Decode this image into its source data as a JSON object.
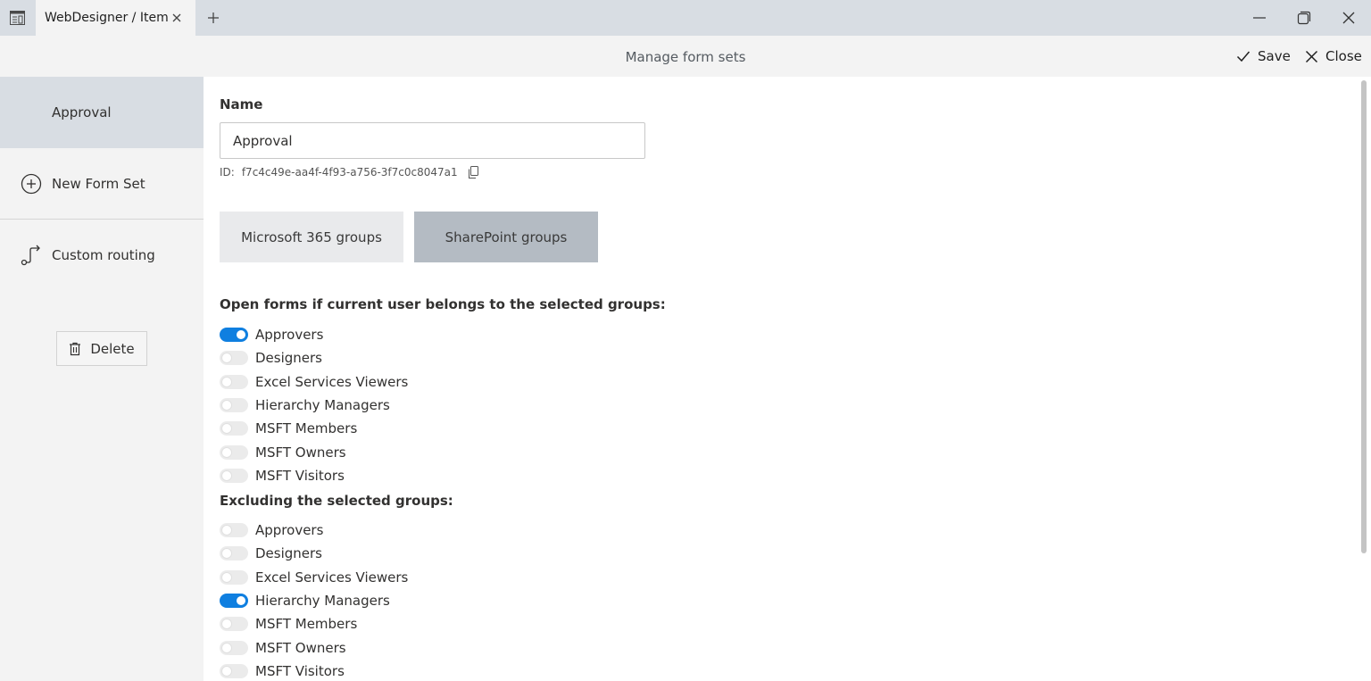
{
  "window": {
    "tab_title": "WebDesigner / Item",
    "icons": {
      "app": "app-window-icon",
      "tab_close": "close-icon",
      "new_tab": "plus-icon",
      "minimize": "minimize-icon",
      "maximize": "restore-icon",
      "close": "close-icon"
    }
  },
  "header": {
    "title": "Manage form sets",
    "save_label": "Save",
    "close_label": "Close"
  },
  "sidebar": {
    "items": [
      {
        "label": "Approval",
        "selected": true
      },
      {
        "label": "New Form Set",
        "icon": "plus-circle-icon"
      },
      {
        "label": "Custom routing",
        "icon": "routing-icon"
      }
    ],
    "delete_label": "Delete"
  },
  "form": {
    "name_label": "Name",
    "name_value": "Approval",
    "id_label": "ID:",
    "id_value": "f7c4c49e-aa4f-4f93-a756-3f7c0c8047a1",
    "group_tabs": [
      {
        "label": "Microsoft 365 groups",
        "selected": false
      },
      {
        "label": "SharePoint groups",
        "selected": true
      }
    ],
    "include_title": "Open forms if current user belongs to the selected groups:",
    "include_groups": [
      {
        "label": "Approvers",
        "on": true
      },
      {
        "label": "Designers",
        "on": false
      },
      {
        "label": "Excel Services Viewers",
        "on": false
      },
      {
        "label": "Hierarchy Managers",
        "on": false
      },
      {
        "label": "MSFT Members",
        "on": false
      },
      {
        "label": "MSFT Owners",
        "on": false
      },
      {
        "label": "MSFT Visitors",
        "on": false
      }
    ],
    "exclude_title": "Excluding the selected groups:",
    "exclude_groups": [
      {
        "label": "Approvers",
        "on": false
      },
      {
        "label": "Designers",
        "on": false
      },
      {
        "label": "Excel Services Viewers",
        "on": false
      },
      {
        "label": "Hierarchy Managers",
        "on": true
      },
      {
        "label": "MSFT Members",
        "on": false
      },
      {
        "label": "MSFT Owners",
        "on": false
      },
      {
        "label": "MSFT Visitors",
        "on": false
      }
    ]
  },
  "colors": {
    "accent": "#0f7fe0",
    "titlebar": "#d8dde3",
    "selected_group_tab": "#b4bbc3"
  }
}
